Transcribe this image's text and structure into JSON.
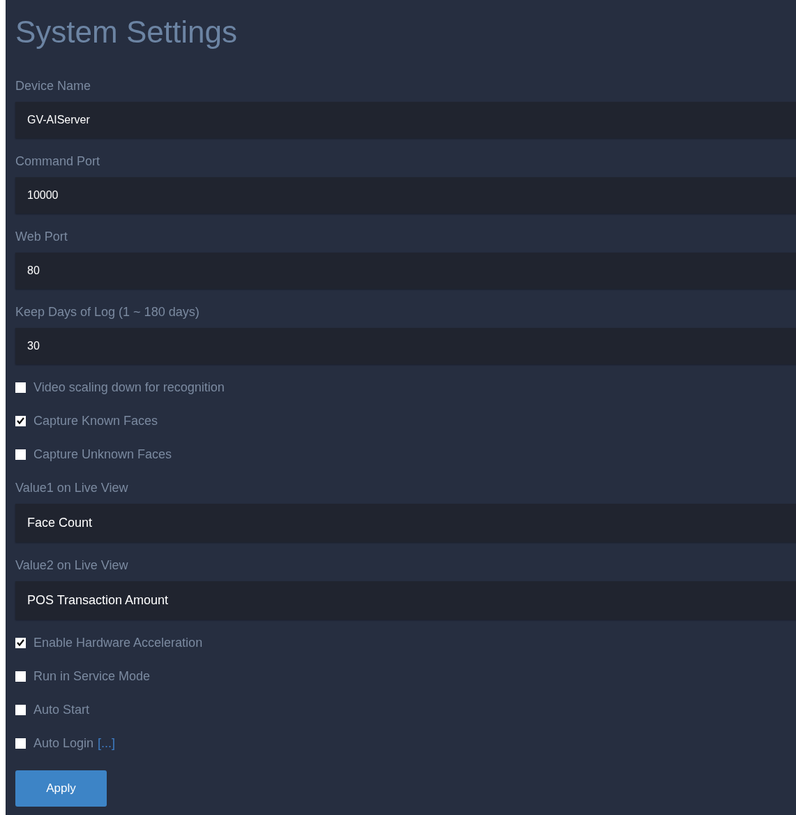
{
  "title": "System Settings",
  "items": [
    {
      "kind": "text",
      "label": "Device Name",
      "value": "GV-AIServer"
    },
    {
      "kind": "text",
      "label": "Command Port",
      "value": "10000"
    },
    {
      "kind": "text",
      "label": "Web Port",
      "value": "80"
    },
    {
      "kind": "text",
      "label": "Keep Days of Log (1 ~ 180 days)",
      "value": "30"
    },
    {
      "kind": "checkbox",
      "label": "Video scaling down for recognition",
      "checked": false
    },
    {
      "kind": "checkbox",
      "label": "Capture Known Faces",
      "checked": true
    },
    {
      "kind": "checkbox",
      "label": "Capture Unknown Faces",
      "checked": false
    },
    {
      "kind": "select",
      "label": "Value1 on Live View",
      "value": "Face Count"
    },
    {
      "kind": "select",
      "label": "Value2 on Live View",
      "value": "POS Transaction Amount"
    },
    {
      "kind": "checkbox",
      "label": "Enable Hardware Acceleration",
      "checked": true
    },
    {
      "kind": "checkbox",
      "label": "Run in Service Mode",
      "checked": false
    },
    {
      "kind": "checkbox",
      "label": "Auto Start",
      "checked": false
    },
    {
      "kind": "checkbox",
      "label": "Auto Login",
      "checked": false,
      "link": "[...]"
    }
  ],
  "apply_button": "Apply"
}
